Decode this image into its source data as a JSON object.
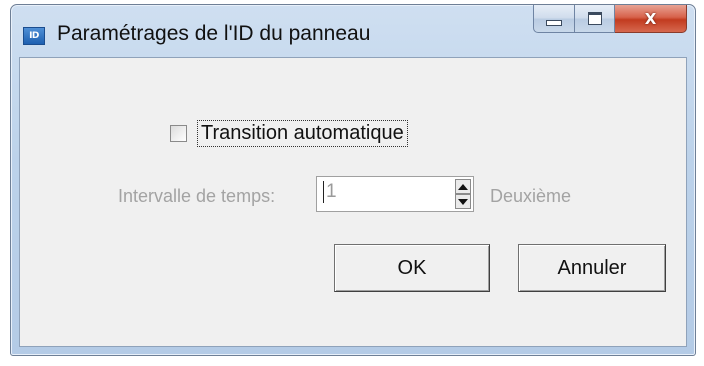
{
  "window": {
    "title": "Paramétrages de l'ID du panneau",
    "app_icon_text": "ID"
  },
  "caption_buttons": {
    "minimize_icon": "minimize-icon",
    "maximize_icon": "maximize-icon",
    "close_icon": "close-icon",
    "close_glyph": "X"
  },
  "form": {
    "auto_transition": {
      "label": "Transition automatique",
      "checked": false
    },
    "interval": {
      "label": "Intervalle de temps:",
      "value": "1",
      "unit": "Deuxième",
      "enabled": false
    }
  },
  "buttons": {
    "ok": "OK",
    "cancel": "Annuler"
  },
  "colors": {
    "frame": "#bcd2ea",
    "client": "#f0f0f0",
    "close_button": "#c23b1f",
    "disabled_text": "#a3a3a3"
  }
}
